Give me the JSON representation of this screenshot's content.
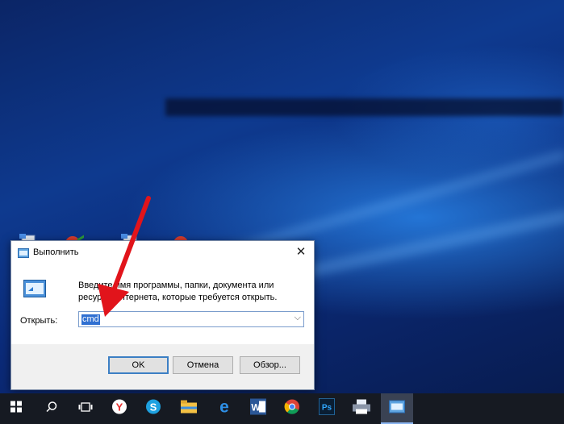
{
  "dialog": {
    "title": "Выполнить",
    "close_glyph": "✕",
    "description": "Введите имя программы, папки, документа или ресурса Интернета, которые требуется открыть.",
    "open_label": "Открыть:",
    "input_value": "cmd",
    "ok_label": "OK",
    "cancel_label": "Отмена",
    "browse_label": "Обзор..."
  },
  "taskbar": {
    "items": [
      "start-icon",
      "search-icon",
      "task-view-icon",
      "yandex-browser-icon",
      "skype-icon",
      "file-explorer-icon",
      "edge-icon",
      "word-icon",
      "chrome-icon",
      "photoshop-icon",
      "printer-icon",
      "run-app-icon"
    ],
    "active": "run-app-icon",
    "word_letter": "W",
    "ps_letters": "Ps",
    "yandex_letter": "Y",
    "skype_letter": "S",
    "edge_letter": "e"
  },
  "colors": {
    "accent": "#2f6fd1",
    "arrow": "#e1141b",
    "taskbar": "#161a22"
  }
}
